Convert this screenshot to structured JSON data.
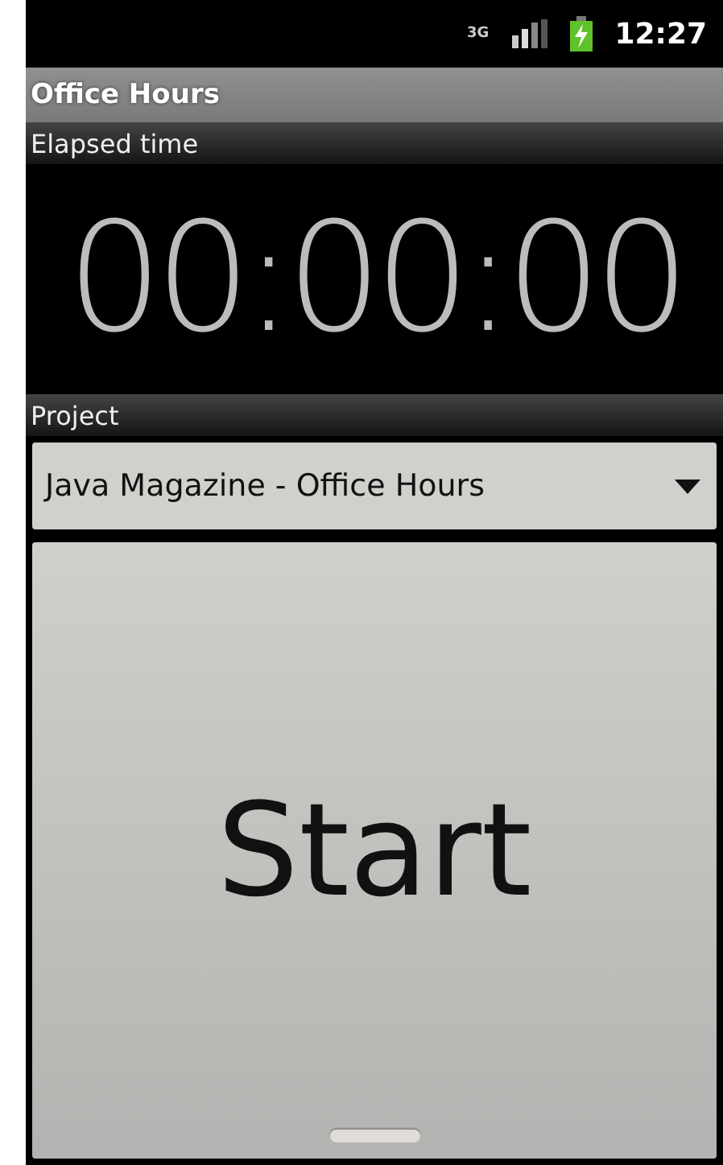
{
  "status_bar": {
    "time": "12:27",
    "network": "3G"
  },
  "title_bar": {
    "title": "Office Hours"
  },
  "elapsed": {
    "header": "Elapsed time",
    "time": "00:00:00"
  },
  "project": {
    "header": "Project",
    "value": "Java Magazine - Office Hours"
  },
  "start_button": {
    "label": "Start"
  }
}
